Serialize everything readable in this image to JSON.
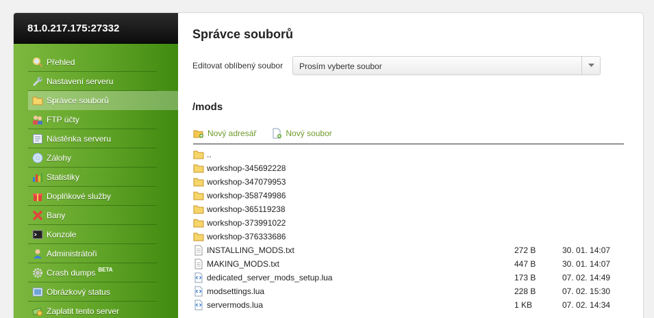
{
  "server": {
    "address": "81.0.217.175:27332"
  },
  "menu": [
    {
      "label": "Přehled",
      "icon": "magnifier-icon",
      "active": false
    },
    {
      "label": "Nastavení serveru",
      "icon": "wrench-icon",
      "active": false
    },
    {
      "label": "Správce souborů",
      "icon": "folder-icon",
      "active": true
    },
    {
      "label": "FTP účty",
      "icon": "users-icon",
      "active": false
    },
    {
      "label": "Nástěnka serveru",
      "icon": "notice-board-icon",
      "active": false
    },
    {
      "label": "Zálohy",
      "icon": "disc-icon",
      "active": false
    },
    {
      "label": "Statistiky",
      "icon": "bar-chart-icon",
      "active": false
    },
    {
      "label": "Doplňkové služby",
      "icon": "gift-icon",
      "active": false
    },
    {
      "label": "Bany",
      "icon": "ban-cross-icon",
      "active": false
    },
    {
      "label": "Konzole",
      "icon": "terminal-icon",
      "active": false
    },
    {
      "label": "Administrátoři",
      "icon": "admin-user-icon",
      "active": false
    },
    {
      "label": "Crash dumps",
      "icon": "cog-icon",
      "active": false,
      "badge": "BETA"
    },
    {
      "label": "Obrázkový status",
      "icon": "image-icon",
      "active": false
    },
    {
      "label": "Zaplatit tento server",
      "icon": "money-icon",
      "active": false
    }
  ],
  "main": {
    "title": "Správce souborů",
    "favorite": {
      "label": "Editovat oblíbený soubor",
      "selected": "Prosím vyberte soubor"
    },
    "path": "/mods",
    "actions": {
      "new_folder": "Nový adresář",
      "new_file": "Nový soubor"
    },
    "files": [
      {
        "name": "..",
        "type": "folder",
        "size": "",
        "date": ""
      },
      {
        "name": "workshop-345692228",
        "type": "folder",
        "size": "",
        "date": ""
      },
      {
        "name": "workshop-347079953",
        "type": "folder",
        "size": "",
        "date": ""
      },
      {
        "name": "workshop-358749986",
        "type": "folder",
        "size": "",
        "date": ""
      },
      {
        "name": "workshop-365119238",
        "type": "folder",
        "size": "",
        "date": ""
      },
      {
        "name": "workshop-373991022",
        "type": "folder",
        "size": "",
        "date": ""
      },
      {
        "name": "workshop-376333686",
        "type": "folder",
        "size": "",
        "date": ""
      },
      {
        "name": "INSTALLING_MODS.txt",
        "type": "text",
        "size": "272 B",
        "date": "30. 01. 14:07"
      },
      {
        "name": "MAKING_MODS.txt",
        "type": "text",
        "size": "447 B",
        "date": "30. 01. 14:07"
      },
      {
        "name": "dedicated_server_mods_setup.lua",
        "type": "lua",
        "size": "173 B",
        "date": "07. 02. 14:49"
      },
      {
        "name": "modsettings.lua",
        "type": "lua",
        "size": "228 B",
        "date": "07. 02. 15:30"
      },
      {
        "name": "servermods.lua",
        "type": "lua",
        "size": "1 KB",
        "date": "07. 02. 14:34"
      }
    ]
  }
}
